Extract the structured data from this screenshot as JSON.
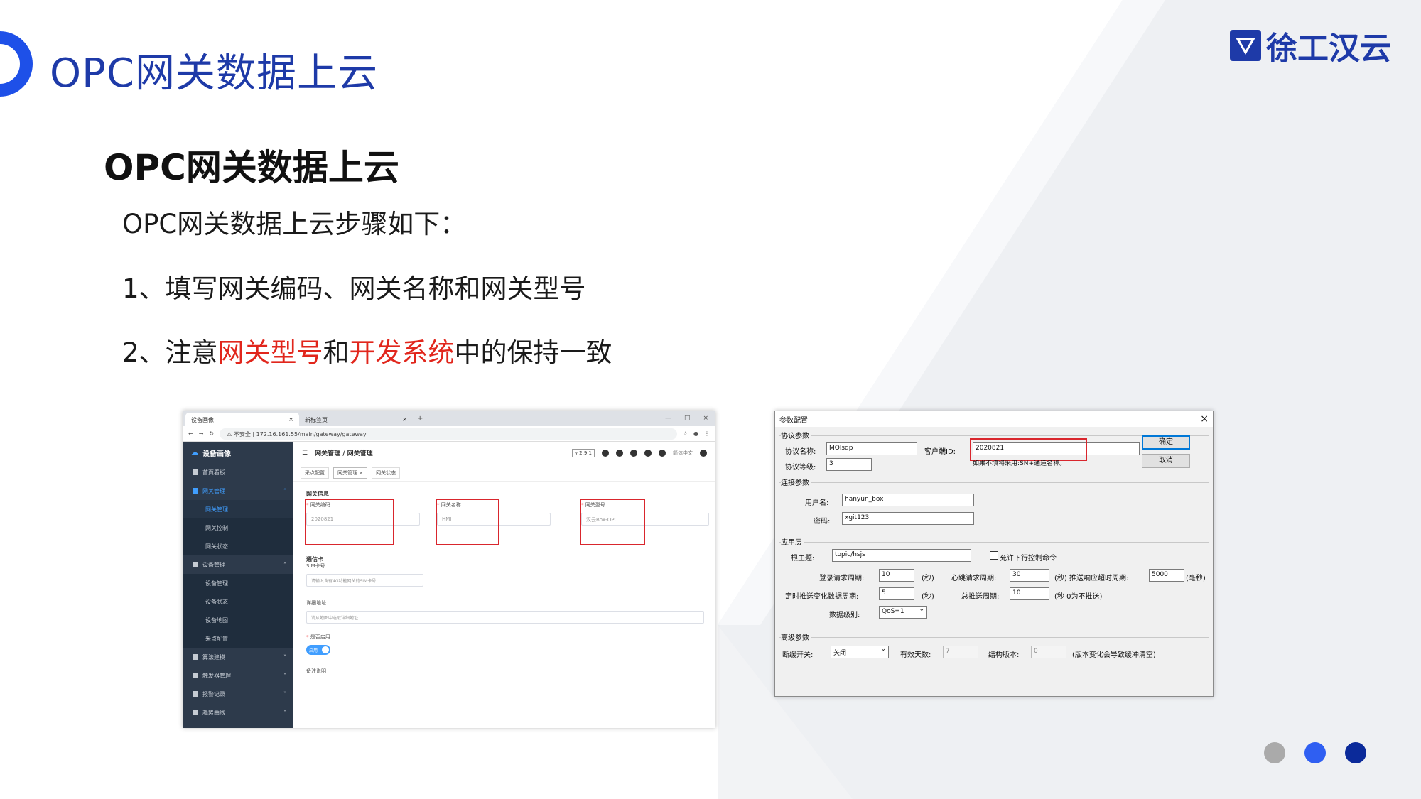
{
  "colors": {
    "brand": "#1e3aa8",
    "accent_red": "#e1261c",
    "dot_grey": "#aaaaaa",
    "dot_blue": "#2f5ff2",
    "dot_navy": "#0b2a9a"
  },
  "slide": {
    "title": "OPC网关数据上云",
    "logo_text": "徐工汉云",
    "subtitle": "OPC网关数据上云",
    "intro": "OPC网关数据上云步骤如下：",
    "step1": "1、填写网关编码、网关名称和网关型号",
    "step2": {
      "prefix": "2、注意",
      "highlight1": "网关型号",
      "mid": "和",
      "highlight2": "开发系统",
      "suffix": "中的保持一致"
    }
  },
  "web_screenshot": {
    "tabs": [
      {
        "label": "设备画像",
        "close": "×"
      },
      {
        "label": "新标签页",
        "close": "×"
      }
    ],
    "new_tab": "+",
    "window_controls": [
      "—",
      "□",
      "×"
    ],
    "address": "⚠ 不安全 | 172.16.161.55/main/gateway/gateway",
    "app_name": "设备画像",
    "menu": [
      {
        "label": "首页看板"
      },
      {
        "label": "网关管理",
        "expanded": true,
        "children": [
          "网关管理",
          "网关控制",
          "网关状态"
        ]
      },
      {
        "label": "设备管理",
        "expanded": true,
        "children": [
          "设备管理",
          "设备状态",
          "设备地图",
          "采点配置"
        ]
      },
      {
        "label": "算法建模"
      },
      {
        "label": "触发器管理"
      },
      {
        "label": "报警记录"
      },
      {
        "label": "趋势曲线"
      }
    ],
    "breadcrumb": "网关管理 / 网关管理",
    "version": "v 2.9.1",
    "lang": "简体中文",
    "page_tabs": [
      "采点配置",
      "网关管理 ×",
      "网关状态"
    ],
    "section_info": "网关信息",
    "gateway_code_label": "网关编码",
    "gateway_code_value": "2020821",
    "gateway_name_label": "网关名称",
    "gateway_name_value": "HMI",
    "gateway_model_label": "网关型号",
    "gateway_model_value": "汉云Box-OPC",
    "section_sim": "通信卡",
    "sim_label": "SIM卡号",
    "sim_placeholder": "请输入含有4G功能网关的SIM卡号",
    "address_label": "详细地址",
    "address_placeholder": "请从地图中选取详细地址",
    "enable_label": "是否启用",
    "enable_value": "启用",
    "remark_label": "备注说明"
  },
  "dialog": {
    "title": "参数配置",
    "close": "×",
    "group_protocol": "协议参数",
    "protocol_name_label": "协议名称:",
    "protocol_name": "MQlsdp",
    "protocol_level_label": "协议等级:",
    "protocol_level": "3",
    "client_id_label": "客户端ID:",
    "client_id": "2020821",
    "client_id_hint": "如果不填将采用:SN+通道名称。",
    "ok": "确定",
    "cancel": "取消",
    "group_conn": "连接参数",
    "username_label": "用户名:",
    "username": "hanyun_box",
    "password_label": "密码:",
    "password": "xgit123",
    "group_app": "应用层",
    "root_topic_label": "根主题:",
    "root_topic": "topic/hsjs",
    "allow_cmd": "允许下行控制命令",
    "login_period_label": "登录请求周期:",
    "login_period": "10",
    "unit_sec": "(秒)",
    "heartbeat_label": "心跳请求周期:",
    "heartbeat": "30",
    "push_timeout_label": "(秒) 推送响应超时周期:",
    "push_timeout": "5000",
    "unit_ms": "(毫秒)",
    "timed_push_label": "定时推送变化数据周期:",
    "timed_push": "5",
    "total_push_label": "总推送周期:",
    "total_push": "10",
    "no_push_hint": "(秒 0为不推送)",
    "data_level_label": "数据级别:",
    "data_level": "QoS=1",
    "group_adv": "高级参数",
    "cache_label": "断缓开关:",
    "cache": "关闭",
    "valid_days_label": "有效天数:",
    "valid_days": "7",
    "struct_ver_label": "结构版本:",
    "struct_ver": "0",
    "struct_hint": "(版本变化会导致缓冲清空)"
  }
}
